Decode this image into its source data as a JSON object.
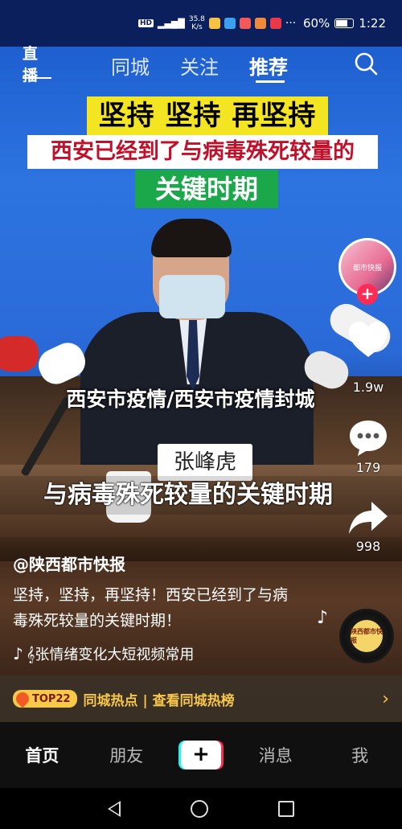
{
  "status_bar": {
    "network": "HD",
    "signal": "4G",
    "speed": "35.8\nK/s",
    "battery": "60%",
    "time": "1:22",
    "more": "···"
  },
  "top_nav": {
    "live_label": "直播",
    "tabs": [
      "同城",
      "关注",
      "推荐"
    ],
    "active_tab": "推荐"
  },
  "video": {
    "banner_line1": "坚持 坚持 再坚持",
    "banner_line2": "西安已经到了与病毒殊死较量的",
    "banner_line3": "关键时期",
    "nameplate": "张峰虎",
    "subtitle": "与病毒殊死较量的关键时期",
    "overlay_title": "西安市疫情/西安市疫情封城"
  },
  "right_rail": {
    "avatar_text": "都市快报",
    "likes": "1.9w",
    "comments": "179",
    "shares": "998",
    "disc_text": "陕西都市快报"
  },
  "post": {
    "author": "@陕西都市快报",
    "description": "坚持，坚持，再坚持！西安已经到了与病毒殊死较量的关键时期！",
    "music": "𝄞张情绪变化大短视频常用"
  },
  "hot_bar": {
    "badge": "TOP22",
    "text": "同城热点 | 查看同城热榜",
    "chevron": "›"
  },
  "bottom_tabs": {
    "home": "首页",
    "friends": "朋友",
    "create": "+",
    "messages": "消息",
    "me": "我"
  },
  "colors": {
    "accent_red": "#fe2c55",
    "accent_cyan": "#25f4ee",
    "hot_gold": "#f6c64b",
    "banner_yellow": "#f4e522",
    "banner_green": "#1aa84a"
  }
}
